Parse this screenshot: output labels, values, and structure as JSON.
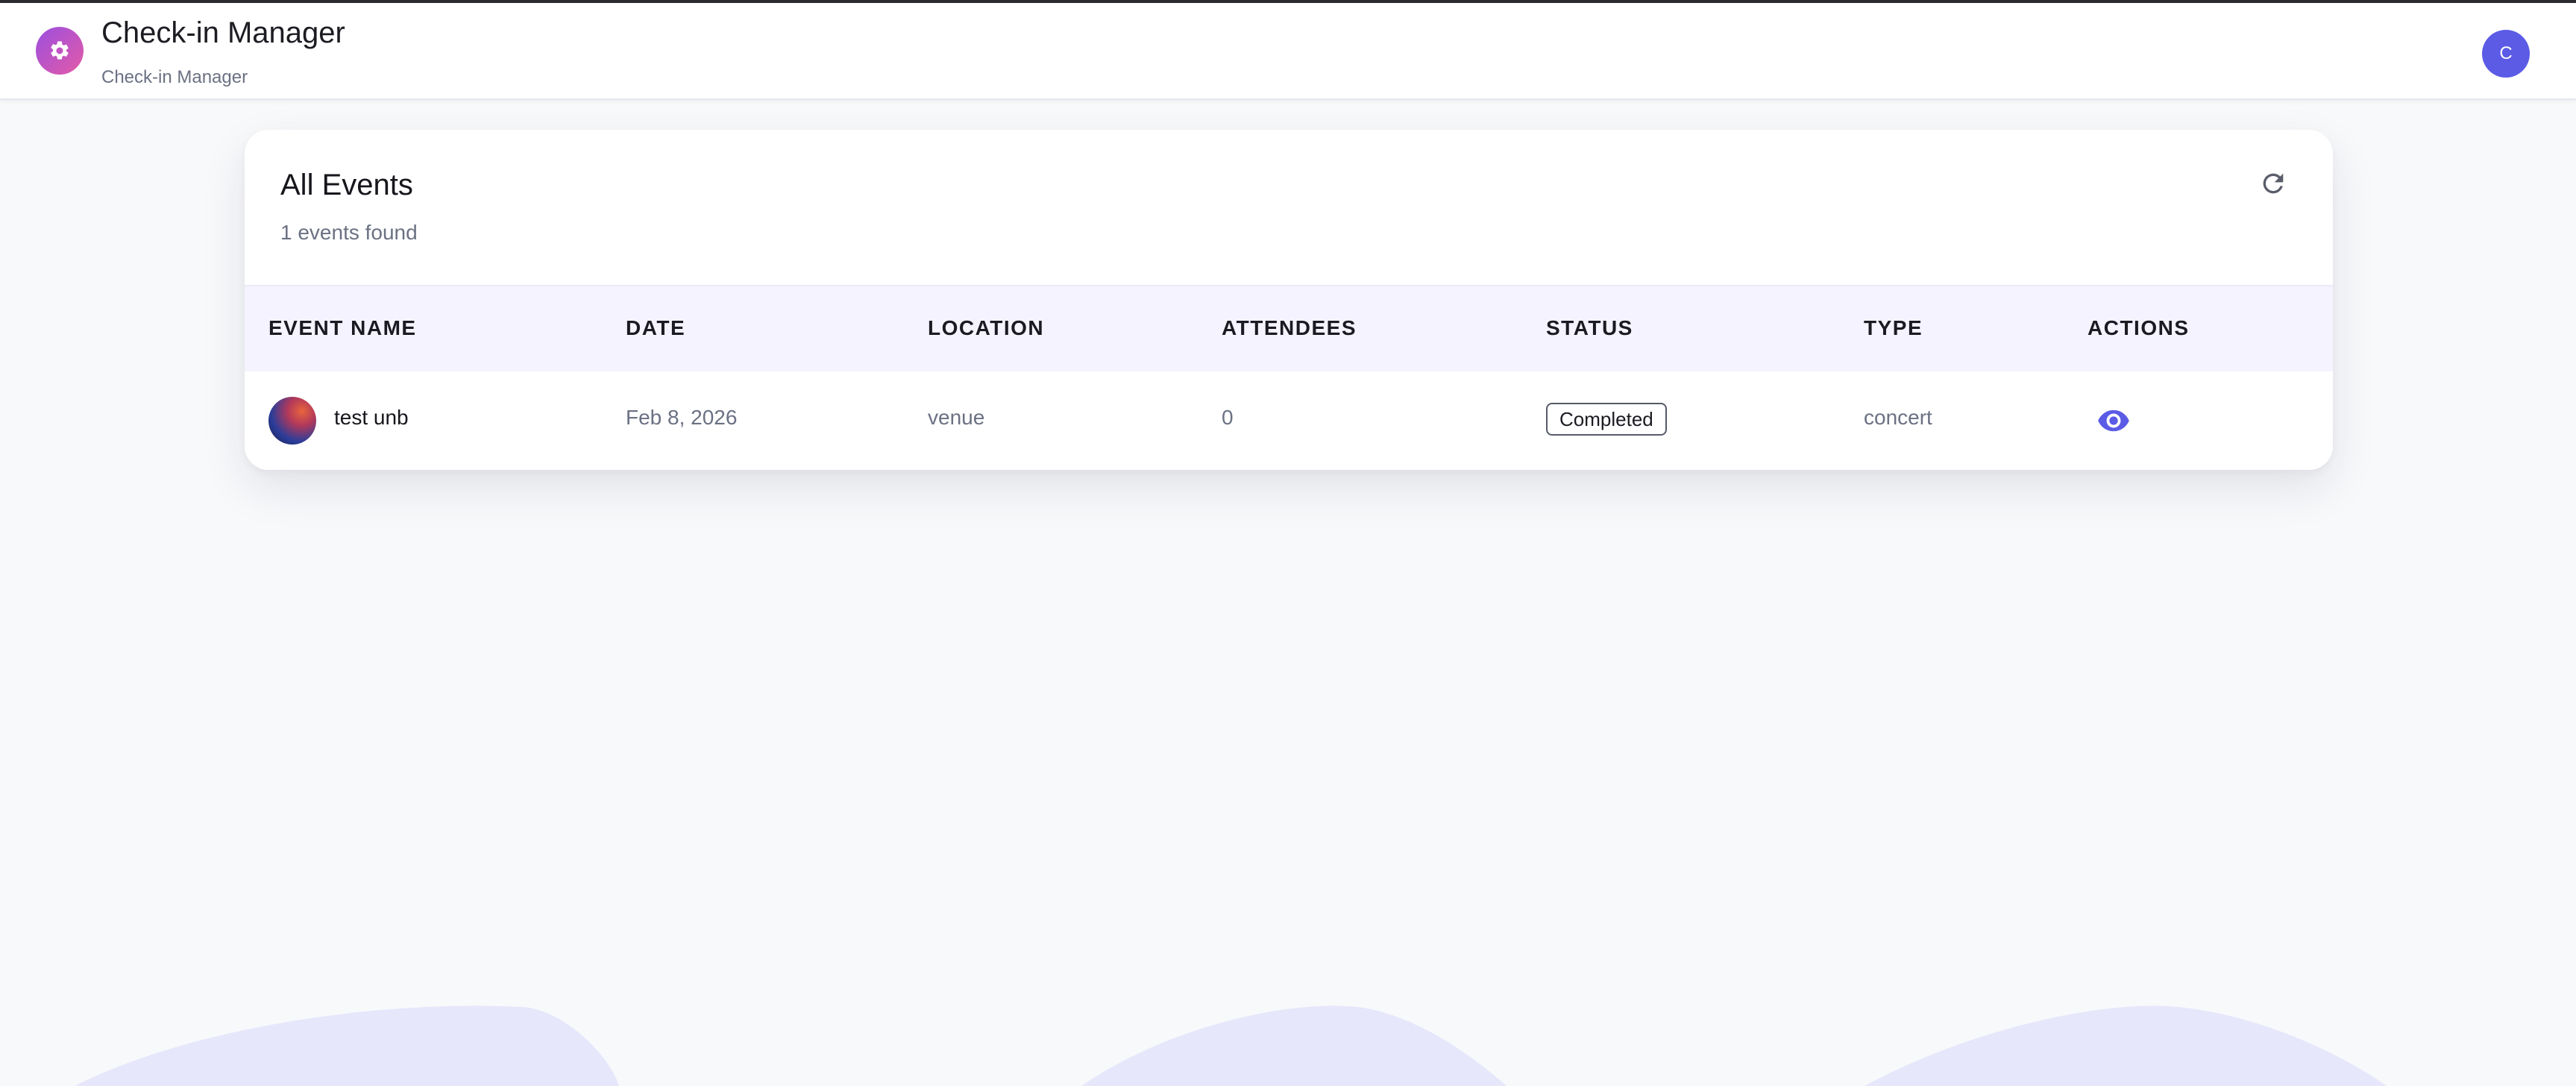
{
  "header": {
    "app_title": "Check-in Manager",
    "app_subtitle": "Check-in Manager",
    "logo_icon": "gear-icon",
    "user_initial": "C",
    "colors": {
      "logo_gradient_start": "#9b4fe0",
      "logo_gradient_end": "#e45aa6",
      "avatar_bg": "#5b5be6"
    }
  },
  "events_card": {
    "title": "All Events",
    "count_text": "1 events found",
    "refresh_icon": "refresh-icon",
    "columns": [
      "EVENT NAME",
      "DATE",
      "LOCATION",
      "ATTENDEES",
      "STATUS",
      "TYPE",
      "ACTIONS"
    ],
    "rows": [
      {
        "event_name": "test unb",
        "date": "Feb 8, 2026",
        "location": "venue",
        "attendees": "0",
        "status": "Completed",
        "type": "concert",
        "action_icon": "eye-icon"
      }
    ],
    "colors": {
      "header_bg": "#f5f3ff",
      "accent": "#5b5be6"
    }
  }
}
